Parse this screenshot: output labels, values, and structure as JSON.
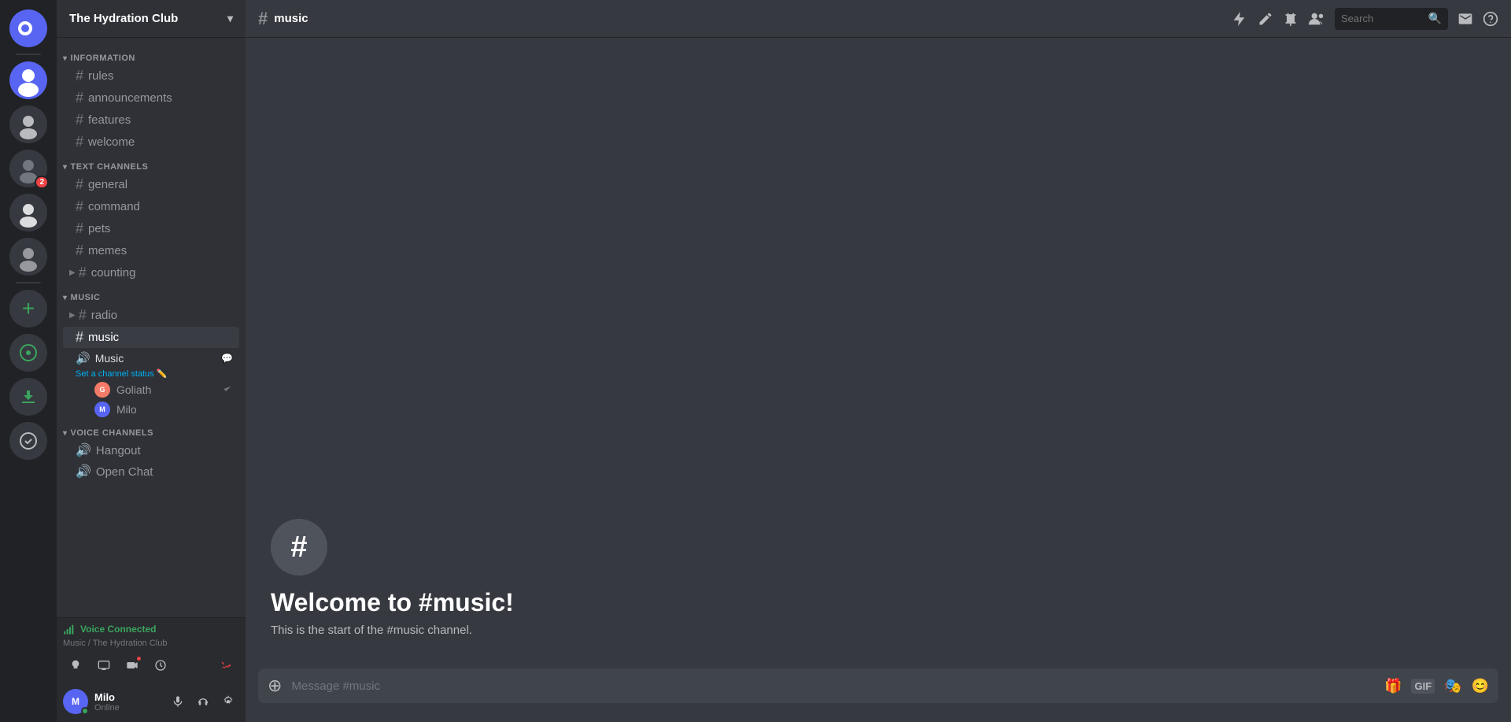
{
  "app": {
    "title": "The Hydration Club"
  },
  "server_sidebar": {
    "icons": [
      {
        "id": "discord-home",
        "label": "Discord Home",
        "symbol": "⬢",
        "type": "home"
      },
      {
        "id": "server-1",
        "label": "Server 1",
        "initials": "",
        "color": "#5865f2",
        "badge": null
      },
      {
        "id": "server-2",
        "label": "Server 2",
        "initials": "",
        "color": "#36393f",
        "badge": null
      },
      {
        "id": "server-3",
        "label": "Server 3",
        "initials": "",
        "color": "#36393f",
        "badge": "2"
      },
      {
        "id": "server-4",
        "label": "Server 4",
        "initials": "",
        "color": "#36393f",
        "badge": null
      },
      {
        "id": "server-5",
        "label": "Server 5",
        "initials": "",
        "color": "#36393f",
        "badge": null
      }
    ],
    "add_server_label": "+",
    "discover_label": "🧭",
    "download_label": "⬇"
  },
  "channel_sidebar": {
    "server_name": "The Hydration Club",
    "categories": [
      {
        "name": "INFORMATION",
        "channels": [
          {
            "id": "rules",
            "name": "rules",
            "type": "text"
          },
          {
            "id": "announcements",
            "name": "announcements",
            "type": "text"
          },
          {
            "id": "features",
            "name": "features",
            "type": "text"
          },
          {
            "id": "welcome",
            "name": "welcome",
            "type": "text"
          }
        ]
      },
      {
        "name": "TEXT CHANNELS",
        "channels": [
          {
            "id": "general",
            "name": "general",
            "type": "text"
          },
          {
            "id": "command",
            "name": "command",
            "type": "text"
          },
          {
            "id": "pets",
            "name": "pets",
            "type": "text"
          },
          {
            "id": "memes",
            "name": "memes",
            "type": "text"
          },
          {
            "id": "counting",
            "name": "counting",
            "type": "text",
            "with_arrow": true
          }
        ]
      },
      {
        "name": "MUSIC",
        "channels": [
          {
            "id": "radio",
            "name": "radio",
            "type": "text",
            "with_arrow": true
          },
          {
            "id": "music",
            "name": "music",
            "type": "text",
            "active": true
          }
        ],
        "voice_channel": {
          "name": "Music",
          "status_label": "Set a channel status",
          "members": [
            {
              "name": "Goliath",
              "initials": "G",
              "color": "#f47b67"
            },
            {
              "name": "Milo",
              "initials": "M",
              "color": "#5865f2"
            }
          ]
        }
      },
      {
        "name": "VOICE CHANNELS",
        "channels": [
          {
            "id": "hangout",
            "name": "Hangout",
            "type": "voice"
          },
          {
            "id": "open-chat",
            "name": "Open Chat",
            "type": "voice"
          }
        ]
      }
    ],
    "voice_connected": {
      "status": "Voice Connected",
      "location": "Music / The Hydration Club"
    },
    "user": {
      "name": "Milo",
      "status": "Online",
      "initials": "M"
    }
  },
  "top_bar": {
    "channel_name": "music",
    "search_placeholder": "Search",
    "icons": [
      "boost",
      "edit",
      "pin",
      "members"
    ]
  },
  "chat": {
    "welcome_title": "Welcome to #music!",
    "welcome_desc": "This is the start of the #music channel.",
    "message_placeholder": "Message #music"
  },
  "toolbar_icons": {
    "boost": "🚀",
    "pin": "📌",
    "members": "👥",
    "inbox": "📥",
    "help": "❓"
  }
}
